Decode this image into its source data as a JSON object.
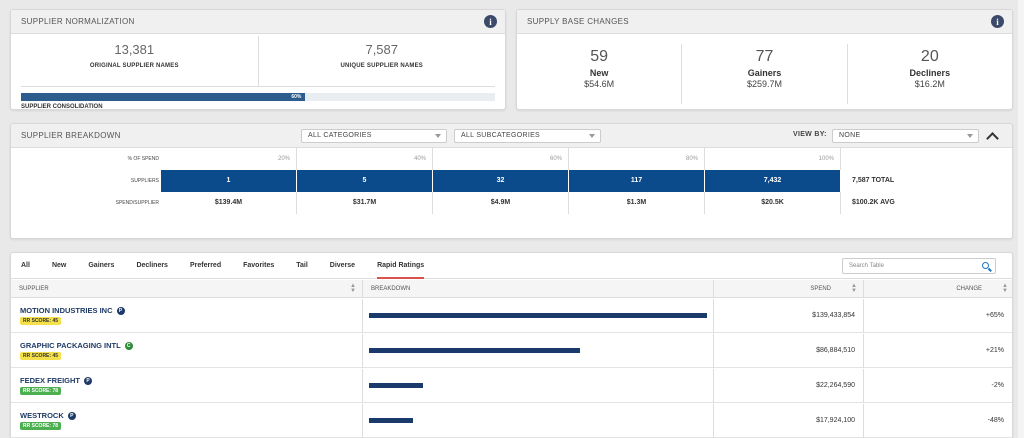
{
  "normalization": {
    "title": "SUPPLIER NORMALIZATION",
    "original_count": "13,381",
    "original_label": "ORIGINAL SUPPLIER NAMES",
    "unique_count": "7,587",
    "unique_label": "UNIQUE SUPPLIER NAMES",
    "consolidation_pct": "60%",
    "consolidation_fraction": 0.6,
    "consolidation_label": "SUPPLIER CONSOLIDATION"
  },
  "supply_base": {
    "title": "SUPPLY BASE CHANGES",
    "items": [
      {
        "count": "59",
        "label": "New",
        "value": "$54.6M"
      },
      {
        "count": "77",
        "label": "Gainers",
        "value": "$259.7M"
      },
      {
        "count": "20",
        "label": "Decliners",
        "value": "$16.2M"
      }
    ]
  },
  "breakdown": {
    "title": "SUPPLIER BREAKDOWN",
    "category_select": "ALL CATEGORIES",
    "subcategory_select": "ALL SUBCATEGORIES",
    "viewby_label": "VIEW BY:",
    "viewby_select": "NONE",
    "row_labels": {
      "pct": "% OF SPEND",
      "suppliers": "SUPPLIERS",
      "spend_per": "SPEND/SUPPLIER"
    },
    "pct_ticks": [
      "20%",
      "40%",
      "60%",
      "80%",
      "100%"
    ],
    "suppliers": [
      "1",
      "5",
      "32",
      "117",
      "7,432"
    ],
    "spend_per": [
      "$139.4M",
      "$31.7M",
      "$4.9M",
      "$1.3M",
      "$20.5K"
    ],
    "total_suppliers": "7,587 TOTAL",
    "avg_spend": "$100.2K AVG"
  },
  "table": {
    "tabs": [
      "All",
      "New",
      "Gainers",
      "Decliners",
      "Preferred",
      "Favorites",
      "Tail",
      "Diverse",
      "Rapid Ratings"
    ],
    "active_tab": "Rapid Ratings",
    "search_placeholder": "Search Table",
    "columns": {
      "supplier": "SUPPLIER",
      "breakdown": "BREAKDOWN",
      "spend": "SPEND",
      "change": "CHANGE"
    },
    "rows": [
      {
        "name": "MOTION INDUSTRIES INC",
        "icon": "P",
        "icon_color": "#1e3a66",
        "rr": "RR SCORE: 45",
        "rr_color": "yellow",
        "fraction": 1.0,
        "spend": "$139,433,854",
        "change": "+65%"
      },
      {
        "name": "GRAPHIC PACKAGING INTL",
        "icon": "C",
        "icon_color": "#2e8b3a",
        "rr": "RR SCORE: 45",
        "rr_color": "yellow",
        "fraction": 0.623,
        "spend": "$86,884,510",
        "change": "+21%"
      },
      {
        "name": "FEDEX FREIGHT",
        "icon": "P",
        "icon_color": "#1e3a66",
        "rr": "RR SCORE: 78",
        "rr_color": "green",
        "fraction": 0.16,
        "spend": "$22,264,590",
        "change": "-2%"
      },
      {
        "name": "WESTROCK",
        "icon": "P",
        "icon_color": "#1e3a66",
        "rr": "RR SCORE: 78",
        "rr_color": "green",
        "fraction": 0.129,
        "spend": "$17,924,100",
        "change": "-48%"
      }
    ]
  }
}
